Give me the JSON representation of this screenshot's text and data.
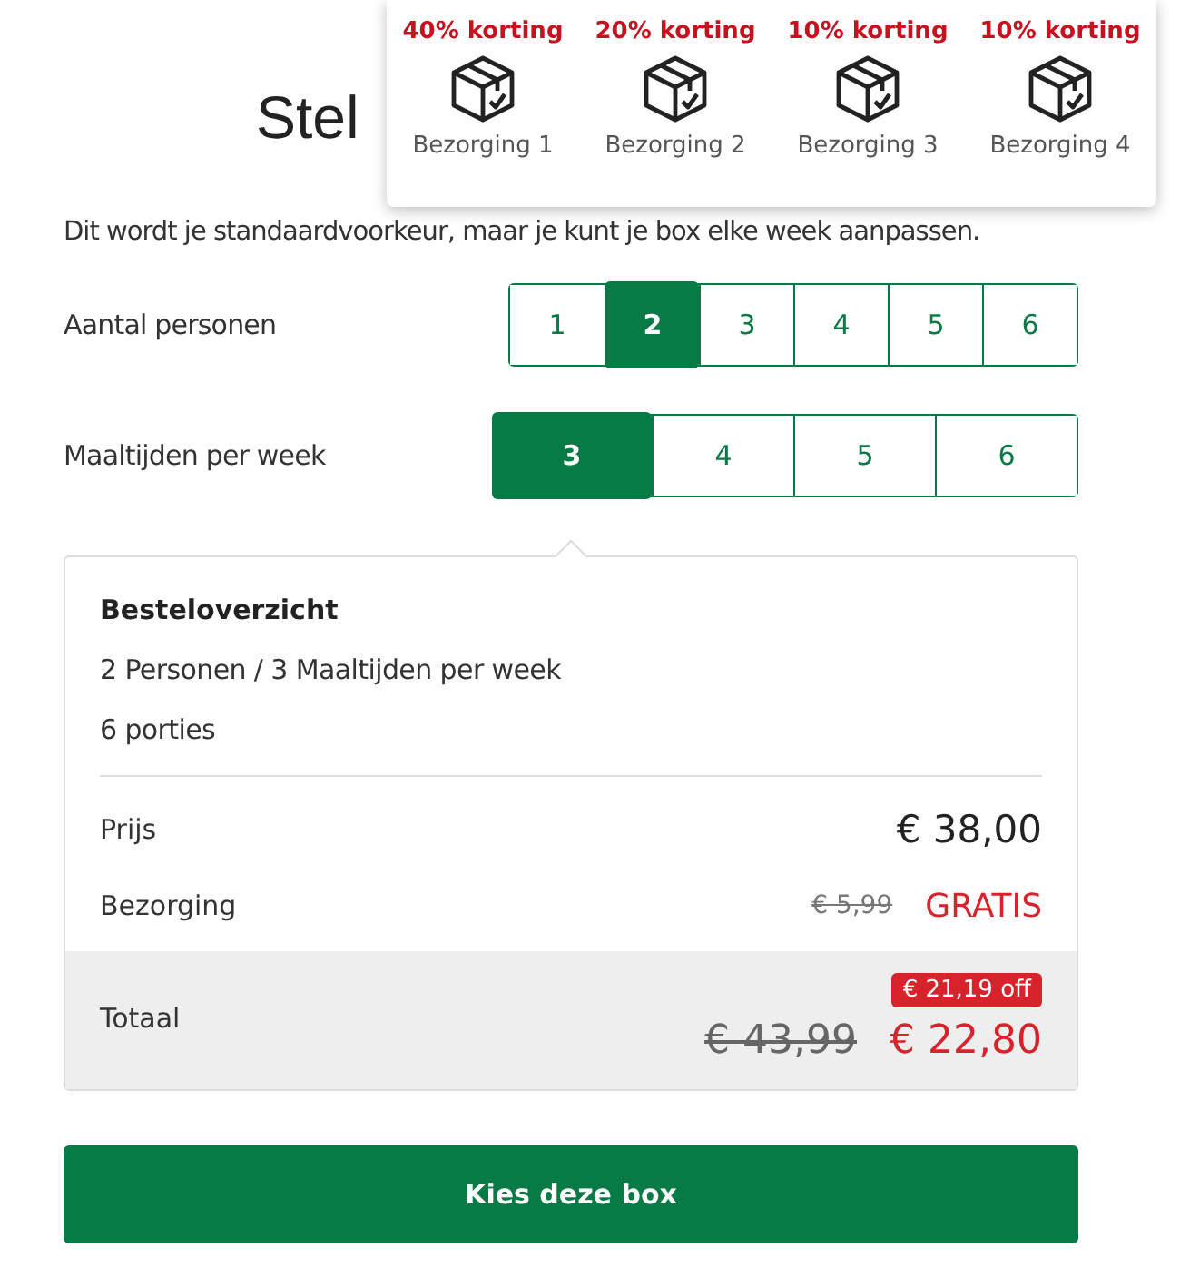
{
  "title": "Stel",
  "subtitle": "Dit wordt je standaardvoorkeur, maar je kunt je box elke week aanpassen.",
  "delivery_popup": [
    {
      "discount": "40% korting",
      "label": "Bezorging 1"
    },
    {
      "discount": "20% korting",
      "label": "Bezorging 2"
    },
    {
      "discount": "10% korting",
      "label": "Bezorging 3"
    },
    {
      "discount": "10% korting",
      "label": "Bezorging 4"
    }
  ],
  "selectors": [
    {
      "label": "Aantal personen",
      "options": [
        {
          "label": "1",
          "selected": false
        },
        {
          "label": "2",
          "selected": true
        },
        {
          "label": "3",
          "selected": false
        },
        {
          "label": "4",
          "selected": false
        },
        {
          "label": "5",
          "selected": false
        },
        {
          "label": "6",
          "selected": false
        }
      ]
    },
    {
      "label": "Maaltijden per week",
      "options": [
        {
          "label": "3",
          "selected": true
        },
        {
          "label": "4",
          "selected": false
        },
        {
          "label": "5",
          "selected": false
        },
        {
          "label": "6",
          "selected": false
        }
      ]
    }
  ],
  "summary": {
    "title": "Besteloverzicht",
    "lines": [
      "2 Personen / 3 Maaltijden per week",
      "6 porties"
    ],
    "price": {
      "label": "Prijs",
      "value": "€ 38,00"
    },
    "delivery": {
      "label": "Bezorging",
      "old": "€ 5,99",
      "value": "GRATIS"
    },
    "total": {
      "label": "Totaal",
      "badge": "€ 21,19 off",
      "old": "€ 43,99",
      "value": "€ 22,80"
    }
  },
  "cta": "Kies deze box"
}
